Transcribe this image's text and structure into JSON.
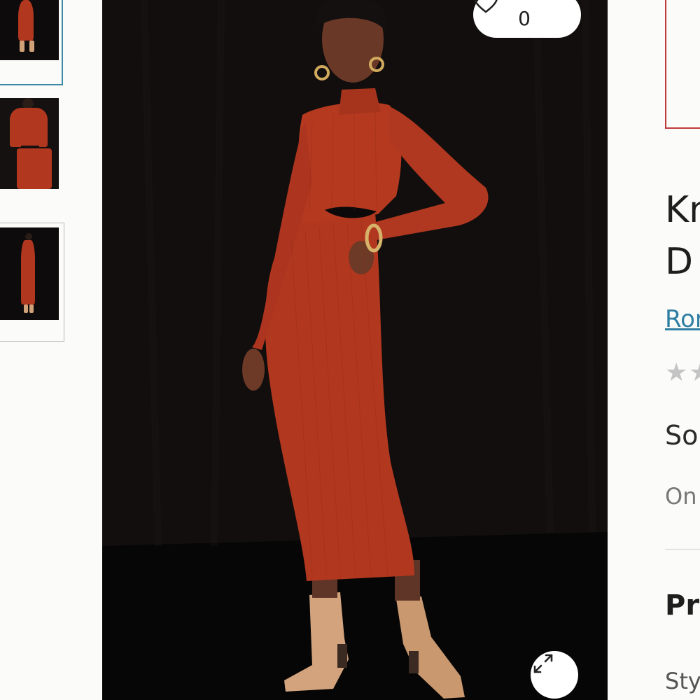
{
  "gallery": {
    "thumbnails": [
      {
        "label": "Thumbnail 1",
        "selected": true
      },
      {
        "label": "Thumbnail 2",
        "selected": false
      },
      {
        "label": "Thumbnail 3",
        "selected": false
      }
    ]
  },
  "hero": {
    "like_count": "0",
    "like_icon": "heart-outline-icon",
    "expand_icon": "expand-arrows-icon"
  },
  "product": {
    "title_line1": "Kn",
    "title_line2": "D",
    "brand": "Ron",
    "rating_stars": "★★",
    "sold_by": "So",
    "online_label": "On",
    "section_heading": "Pro",
    "style_label": "Sty"
  },
  "colors": {
    "accent_link": "#2f7ea3",
    "selected_thumb_border": "#3d8aa6",
    "swatch_border": "#c0393b",
    "dress": "#b2371f",
    "background": "#0b0909"
  }
}
